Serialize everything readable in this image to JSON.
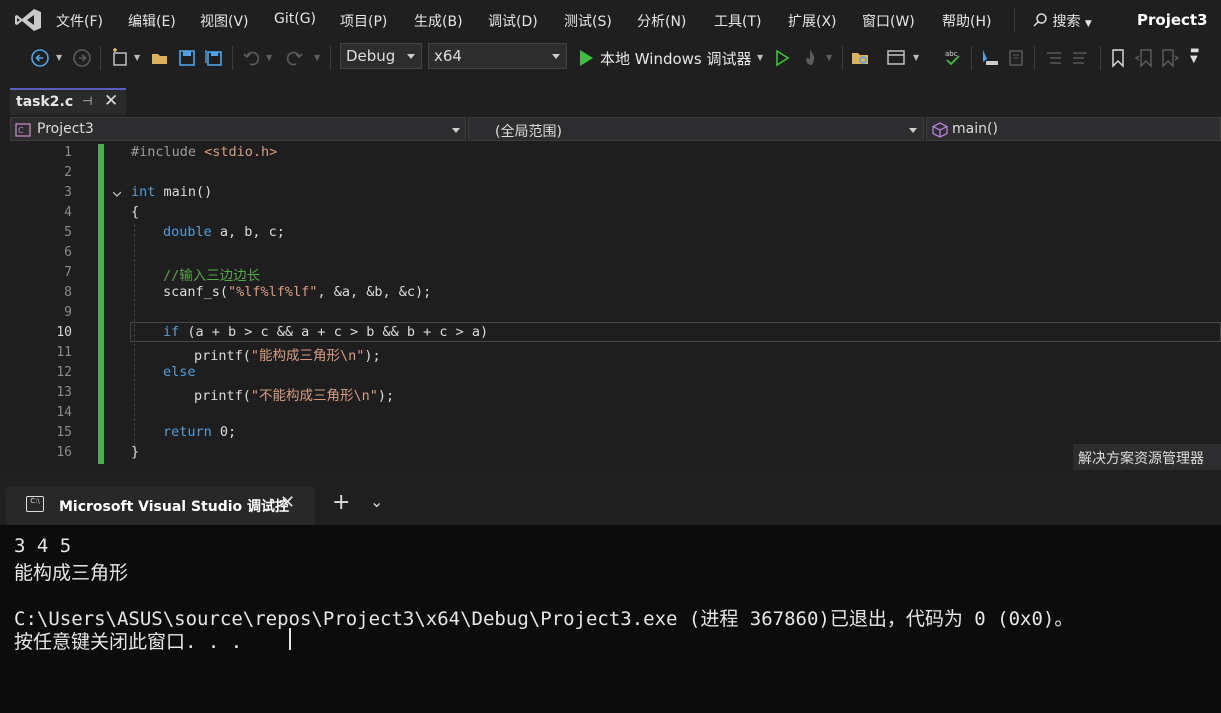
{
  "menu": {
    "items": [
      "文件(F)",
      "编辑(E)",
      "视图(V)",
      "Git(G)",
      "项目(P)",
      "生成(B)",
      "调试(D)",
      "测试(S)",
      "分析(N)",
      "工具(T)",
      "扩展(X)",
      "窗口(W)",
      "帮助(H)"
    ],
    "search_label": "搜索",
    "project_title": "Project3"
  },
  "toolbar": {
    "configuration": "Debug",
    "platform": "x64",
    "run_label": "本地 Windows 调试器"
  },
  "tabs": {
    "file_tab": "task2.c"
  },
  "navbar": {
    "project": "Project3",
    "scope": "(全局范围)",
    "member": "main()"
  },
  "editor": {
    "current_line": 10,
    "line_numbers": [
      "1",
      "2",
      "3",
      "4",
      "5",
      "6",
      "7",
      "8",
      "9",
      "10",
      "11",
      "12",
      "13",
      "14",
      "15",
      "16"
    ]
  },
  "solution_explorer_tab": "解决方案资源管理器",
  "terminal": {
    "tab_title": "Microsoft Visual Studio 调试控",
    "lines": [
      "3 4 5",
      "能构成三角形",
      "",
      "C:\\Users\\ASUS\\source\\repos\\Project3\\x64\\Debug\\Project3.exe (进程 367860)已退出，代码为 0 (0x0)。",
      "按任意键关闭此窗口. . ."
    ]
  },
  "colors": {
    "keyword": "#569cd6",
    "string": "#d69d85",
    "comment": "#57a64a",
    "change_bar": "#48b14c"
  }
}
